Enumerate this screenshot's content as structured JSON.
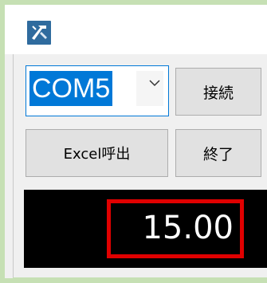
{
  "port_select": {
    "value": "COM5"
  },
  "buttons": {
    "connect_label": "接続",
    "excel_label": "Excel呼出",
    "exit_label": "終了"
  },
  "display": {
    "reading": "15.00"
  },
  "icons": {
    "app": "caliper-icon",
    "dropdown": "chevron-down-icon"
  },
  "colors": {
    "accent": "#0078d7",
    "highlight_border": "#e00000",
    "frame": "#c6e0b4",
    "display_bg": "#000000"
  }
}
